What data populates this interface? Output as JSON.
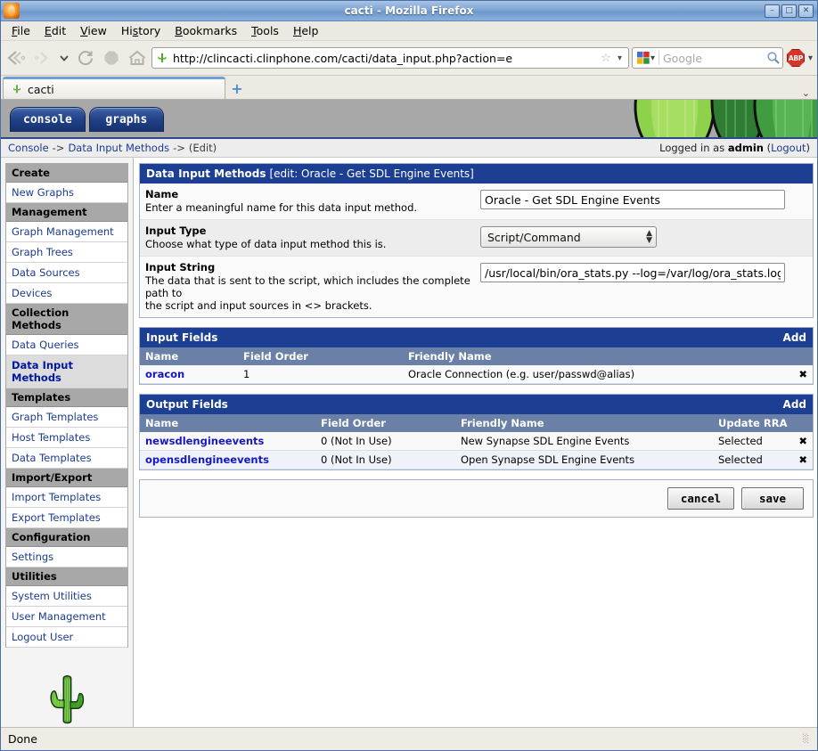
{
  "window": {
    "title": "cacti - Mozilla Firefox",
    "minimize_label": "–",
    "maximize_label": "□",
    "close_label": "✕"
  },
  "menubar": {
    "items": [
      "File",
      "Edit",
      "View",
      "History",
      "Bookmarks",
      "Tools",
      "Help"
    ]
  },
  "toolbar": {
    "back_label": "Back",
    "forward_label": "Forward",
    "history_dropdown_label": "▾",
    "reload_label": "Reload",
    "stop_label": "Stop",
    "home_label": "Home",
    "url": "http://clincacti.clinphone.com/cacti/data_input.php?action=e",
    "url_star": "☆",
    "url_dropdown": "▾",
    "search_placeholder": "Google",
    "search_engine": "Google",
    "search_dropdown": "▾",
    "adblock_label": "ABP",
    "adblock_dropdown": "▾"
  },
  "tabstrip": {
    "tabs": [
      {
        "label": "cacti"
      }
    ],
    "new_tab_label": "+",
    "list_all_tabs_label": "⌄"
  },
  "cacti": {
    "tabs": [
      "console",
      "graphs"
    ],
    "breadcrumb": {
      "console": "Console",
      "sep1": "->",
      "section": "Data Input Methods",
      "sep2": "->",
      "current": "(Edit)"
    },
    "login": {
      "prefix": "Logged in as",
      "user": "admin",
      "open_paren": "(",
      "logout": "Logout",
      "close_paren": ")"
    },
    "sidebar": {
      "groups": [
        {
          "header": "Create",
          "links": [
            "New Graphs"
          ]
        },
        {
          "header": "Management",
          "links": [
            "Graph Management",
            "Graph Trees",
            "Data Sources",
            "Devices"
          ]
        },
        {
          "header": "Collection Methods",
          "links": [
            "Data Queries",
            "Data Input Methods"
          ]
        },
        {
          "header": "Templates",
          "links": [
            "Graph Templates",
            "Host Templates",
            "Data Templates"
          ]
        },
        {
          "header": "Import/Export",
          "links": [
            "Import Templates",
            "Export Templates"
          ]
        },
        {
          "header": "Configuration",
          "links": [
            "Settings"
          ]
        },
        {
          "header": "Utilities",
          "links": [
            "System Utilities",
            "User Management",
            "Logout User"
          ]
        }
      ],
      "current_link": "Data Input Methods"
    },
    "details_panel": {
      "title_strong": "Data Input Methods",
      "title_rest": "[edit: Oracle - Get SDL Engine Events]",
      "rows": [
        {
          "label": "Name",
          "description": "Enter a meaningful name for this data input method.",
          "control": "text",
          "value": "Oracle - Get SDL Engine Events"
        },
        {
          "label": "Input Type",
          "description": "Choose what type of data input method this is.",
          "control": "select",
          "value": "Script/Command"
        },
        {
          "label": "Input String",
          "description": "The data that is sent to the script, which includes the complete path to the script and input sources in <> brackets.",
          "description_line1": "The data that is sent to the script, which includes the complete path to",
          "description_line2": "the script and input sources in <> brackets.",
          "control": "text",
          "value": "/usr/local/bin/ora_stats.py --log=/var/log/ora_stats.log"
        }
      ]
    },
    "input_fields": {
      "title": "Input Fields",
      "add_label": "Add",
      "columns": [
        "Name",
        "Field Order",
        "Friendly Name",
        ""
      ],
      "rows": [
        {
          "name": "oracon",
          "field_order": "1",
          "friendly_name": "Oracle Connection (e.g. user/passwd@alias)",
          "delete": "✖"
        }
      ]
    },
    "output_fields": {
      "title": "Output Fields",
      "add_label": "Add",
      "columns": [
        "Name",
        "Field Order",
        "Friendly Name",
        "Update RRA",
        ""
      ],
      "rows": [
        {
          "name": "newsdlengineevents",
          "field_order": "0 (Not In Use)",
          "friendly_name": "New Synapse SDL Engine Events",
          "update_rra": "Selected",
          "delete": "✖"
        },
        {
          "name": "opensdlengineevents",
          "field_order": "0 (Not In Use)",
          "friendly_name": "Open Synapse SDL Engine Events",
          "update_rra": "Selected",
          "delete": "✖"
        }
      ]
    },
    "actions": {
      "cancel_label": "cancel",
      "save_label": "save"
    }
  },
  "statusbar": {
    "text": "Done"
  },
  "colors": {
    "panel_header": "#1c3f94",
    "table_header": "#6a80a7",
    "link": "#1a3b8f",
    "delete_x": "#cf2a18",
    "cactus_green": "#4aa32e",
    "banner_gray": "#a8a8a8"
  }
}
